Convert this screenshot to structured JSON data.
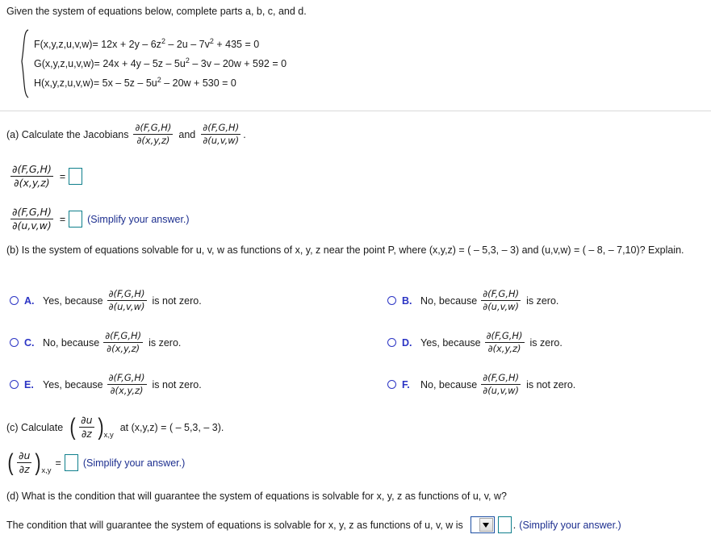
{
  "intro": "Given the system of equations below, complete parts a, b, c, and d.",
  "system": {
    "equations": [
      {
        "lhs": "F(x,y,z,u,v,w)",
        "parts": [
          "= 12x + 2y – 6z",
          "2",
          " – 2u – 7v",
          "2",
          " + 435 = 0"
        ]
      },
      {
        "lhs": "G(x,y,z,u,v,w)",
        "parts": [
          "= 24x + 4y – 5z – 5u",
          "2",
          " – 3v – 20w + 592 = 0"
        ]
      },
      {
        "lhs": "H(x,y,z,u,v,w)",
        "parts": [
          "= 5x – 5z – 5u",
          "2",
          " – 20w + 530 = 0"
        ]
      }
    ]
  },
  "jacobian": {
    "numerator": "∂(F,G,H)",
    "den_xyz": "∂(x,y,z)",
    "den_uvw": "∂(u,v,w)"
  },
  "part_a": {
    "prompt_prefix": "(a) Calculate the Jacobians",
    "conjunction": "and",
    "period": ".",
    "equals": "=",
    "simplify_note": "(Simplify your answer.)"
  },
  "part_b": {
    "question": "(b) Is the system of equations solvable for u, v, w as functions of x, y, z near the point P, where (x,y,z) = ( – 5,3, – 3) and (u,v,w) = ( – 8, – 7,10)? Explain.",
    "options": [
      {
        "letter": "A.",
        "lead": "Yes, because",
        "den": "∂(u,v,w)",
        "tail": "is not zero."
      },
      {
        "letter": "B.",
        "lead": "No, because",
        "den": "∂(u,v,w)",
        "tail": "is zero."
      },
      {
        "letter": "C.",
        "lead": "No, because",
        "den": "∂(x,y,z)",
        "tail": "is zero."
      },
      {
        "letter": "D.",
        "lead": "Yes, because",
        "den": "∂(x,y,z)",
        "tail": "is zero."
      },
      {
        "letter": "E.",
        "lead": "Yes, because",
        "den": "∂(x,y,z)",
        "tail": "is not zero."
      },
      {
        "letter": "F.",
        "lead": "No, because",
        "den": "∂(u,v,w)",
        "tail": "is not zero."
      }
    ]
  },
  "part_c": {
    "prompt_prefix": "(c) Calculate",
    "deriv_num": "∂u",
    "deriv_den": "∂z",
    "deriv_sub": "x,y",
    "prompt_suffix": "at (x,y,z) = ( – 5,3, – 3).",
    "equals": "=",
    "simplify_note": "(Simplify your answer.)"
  },
  "part_d": {
    "question": "(d) What is the condition that will guarantee the system of equations is solvable for x, y, z as functions of u, v, w?",
    "answer_prefix": "The condition that will guarantee the system of equations is solvable for x, y, z as functions of u, v, w is",
    "dropdown_value": "",
    "period": ".",
    "simplify_note": "(Simplify your answer.)"
  },
  "colors": {
    "text": "#1a1a1a",
    "blue_label": "#2b34c4",
    "hint_blue": "#1d2f8f",
    "answer_box_border": "#0f7f8c",
    "dropdown_border": "#1d4fa3",
    "divider": "#d9d9d9"
  }
}
